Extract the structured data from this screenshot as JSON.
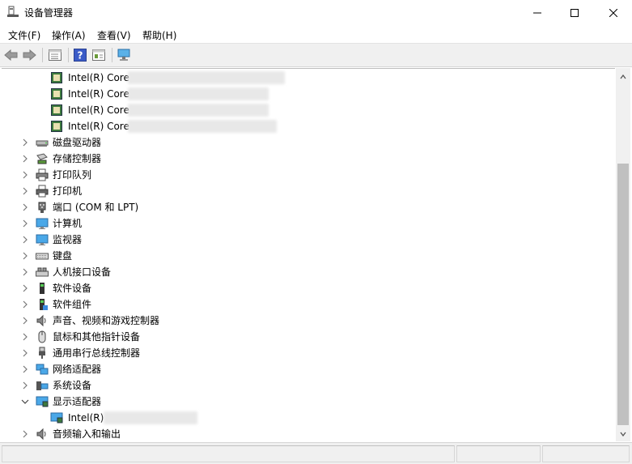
{
  "window": {
    "title": "设备管理器"
  },
  "menu": [
    {
      "label": "文件(F)"
    },
    {
      "label": "操作(A)"
    },
    {
      "label": "查看(V)"
    },
    {
      "label": "帮助(H)"
    }
  ],
  "tree": {
    "processors": [
      "Intel(R) Core",
      "Intel(R) Core",
      "Intel(R) Core",
      "Intel(R) Core"
    ],
    "categories": [
      {
        "label": "磁盘驱动器",
        "icon": "disk-drive-icon"
      },
      {
        "label": "存储控制器",
        "icon": "storage-controller-icon"
      },
      {
        "label": "打印队列",
        "icon": "print-queue-icon"
      },
      {
        "label": "打印机",
        "icon": "printer-icon"
      },
      {
        "label": "端口 (COM 和 LPT)",
        "icon": "port-icon"
      },
      {
        "label": "计算机",
        "icon": "computer-icon"
      },
      {
        "label": "监视器",
        "icon": "monitor-icon"
      },
      {
        "label": "键盘",
        "icon": "keyboard-icon"
      },
      {
        "label": "人机接口设备",
        "icon": "hid-icon"
      },
      {
        "label": "软件设备",
        "icon": "software-device-icon"
      },
      {
        "label": "软件组件",
        "icon": "software-component-icon"
      },
      {
        "label": "声音、视频和游戏控制器",
        "icon": "sound-icon"
      },
      {
        "label": "鼠标和其他指针设备",
        "icon": "mouse-icon"
      },
      {
        "label": "通用串行总线控制器",
        "icon": "usb-icon"
      },
      {
        "label": "网络适配器",
        "icon": "network-adapter-icon"
      },
      {
        "label": "系统设备",
        "icon": "system-device-icon"
      },
      {
        "label": "显示适配器",
        "icon": "display-adapter-icon",
        "expanded": true
      }
    ],
    "display_child": "Intel(R)",
    "last_category": {
      "label": "音频输入和输出",
      "icon": "audio-io-icon"
    }
  }
}
